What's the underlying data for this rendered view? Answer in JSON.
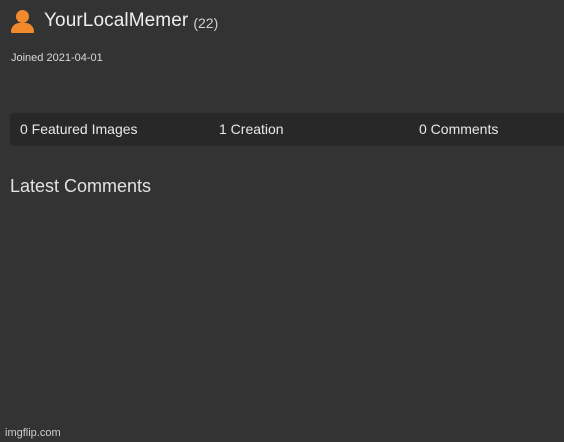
{
  "profile": {
    "username": "YourLocalMemer",
    "points": "(22)",
    "joined": "Joined 2021-04-01",
    "icon": "user-icon",
    "accent_color": "#f08a2c"
  },
  "stats": {
    "featured_images": "0 Featured Images",
    "creations": "1 Creation",
    "comments": "0 Comments"
  },
  "latest_comments": {
    "title": "Latest Comments",
    "items": []
  },
  "watermark": "imgflip.com"
}
